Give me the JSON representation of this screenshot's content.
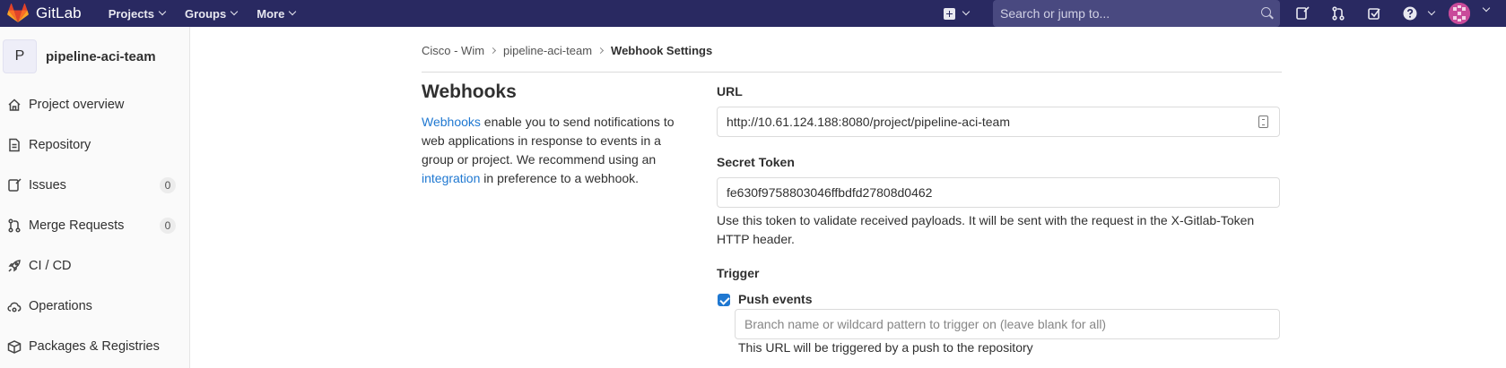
{
  "navbar": {
    "brand": "GitLab",
    "menu": [
      {
        "label": "Projects"
      },
      {
        "label": "Groups"
      },
      {
        "label": "More"
      }
    ],
    "search_placeholder": "Search or jump to...",
    "icons": [
      "plus-square-icon",
      "search-icon",
      "issues-icon",
      "merge-request-icon",
      "todo-icon",
      "help-icon",
      "avatar"
    ],
    "colors": {
      "bar": "#292961",
      "search": "#494980"
    }
  },
  "sidebar": {
    "project_initial": "P",
    "project_name": "pipeline-aci-team",
    "items": [
      {
        "label": "Project overview",
        "icon": "home-icon"
      },
      {
        "label": "Repository",
        "icon": "document-icon"
      },
      {
        "label": "Issues",
        "icon": "issues-icon",
        "badge": "0"
      },
      {
        "label": "Merge Requests",
        "icon": "merge-request-icon",
        "badge": "0"
      },
      {
        "label": "CI / CD",
        "icon": "rocket-icon"
      },
      {
        "label": "Operations",
        "icon": "cloud-gear-icon"
      },
      {
        "label": "Packages & Registries",
        "icon": "package-icon"
      }
    ]
  },
  "breadcrumb": {
    "items": [
      "Cisco - Wim",
      "pipeline-aci-team"
    ],
    "current": "Webhook Settings"
  },
  "webhooks": {
    "title": "Webhooks",
    "desc_link1": "Webhooks",
    "desc_part1": " enable you to send notifications to web applications in response to events in a group or project. We recommend using an ",
    "desc_link2": "integration",
    "desc_part2": " in preference to a webhook."
  },
  "form": {
    "url_label": "URL",
    "url_value": "http://10.61.124.188:8080/project/pipeline-aci-team",
    "secret_label": "Secret Token",
    "secret_value": "fe630f9758803046ffbdfd27808d0462",
    "secret_help": "Use this token to validate received payloads. It will be sent with the request in the X-Gitlab-Token HTTP header.",
    "trigger_label": "Trigger",
    "push_events_label": "Push events",
    "push_events_checked": true,
    "branch_placeholder": "Branch name or wildcard pattern to trigger on (leave blank for all)",
    "push_help": "This URL will be triggered by a push to the repository",
    "accent_color": "#1f78d1"
  }
}
